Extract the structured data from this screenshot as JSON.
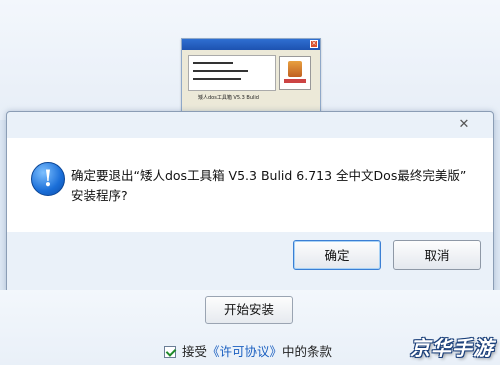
{
  "background_window": {
    "thumbnail_text": "矮人dos工具箱 V5.3 Bulid"
  },
  "dialog": {
    "close_glyph": "✕",
    "icon_glyph": "!",
    "message_line1": "确定要退出“矮人dos工具箱 V5.3 Bulid 6.713 全中文Dos最终完美版”",
    "message_line2": "安装程序?",
    "ok_label": "确定",
    "cancel_label": "取消"
  },
  "installer": {
    "install_label": "开始安装",
    "agree_prefix": "接受",
    "agree_link": "《许可协议》",
    "agree_suffix": "中的条款",
    "agree_checked": true
  },
  "watermark": "京华手游"
}
